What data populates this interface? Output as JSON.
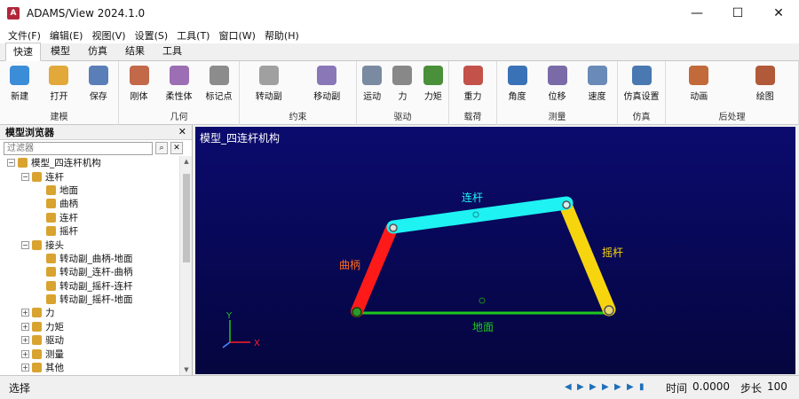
{
  "window": {
    "title": "ADAMS/View 2024.1.0",
    "minimize": "—",
    "maximize": "☐",
    "close": "✕"
  },
  "menu": [
    "文件(F)",
    "编辑(E)",
    "视图(V)",
    "设置(S)",
    "工具(T)",
    "窗口(W)",
    "帮助(H)"
  ],
  "tabs": [
    "快速",
    "模型",
    "仿真",
    "结果",
    "工具"
  ],
  "ribbon": {
    "groups": [
      {
        "label": "建模",
        "tools": [
          {
            "label": "新建",
            "color": "#3c8dd8"
          },
          {
            "label": "打开",
            "color": "#e2a93a"
          },
          {
            "label": "保存",
            "color": "#5a7fb8"
          }
        ]
      },
      {
        "label": "几何",
        "tools": [
          {
            "label": "刚体",
            "color": "#c2694a"
          },
          {
            "label": "柔性体",
            "color": "#9c6fb5"
          },
          {
            "label": "标记点",
            "color": "#8c8c8c"
          }
        ]
      },
      {
        "label": "约束",
        "tools": [
          {
            "label": "转动副",
            "color": "#a0a0a0"
          },
          {
            "label": "移动副",
            "color": "#8a77b8"
          }
        ]
      },
      {
        "label": "驱动",
        "tools": [
          {
            "label": "运动",
            "color": "#7a8aa0"
          },
          {
            "label": "力",
            "color": "#888888"
          },
          {
            "label": "力矩",
            "color": "#4a8f3a"
          }
        ]
      },
      {
        "label": "载荷",
        "tools": [
          {
            "label": "重力",
            "color": "#c2524a"
          }
        ]
      },
      {
        "label": "测量",
        "tools": [
          {
            "label": "角度",
            "color": "#3a72b8"
          },
          {
            "label": "位移",
            "color": "#7a6aa8"
          },
          {
            "label": "速度",
            "color": "#6a8ab8"
          }
        ]
      },
      {
        "label": "仿真",
        "tools": [
          {
            "label": "仿真设置",
            "color": "#4a78b0"
          }
        ]
      },
      {
        "label": "后处理",
        "tools": [
          {
            "label": "动画",
            "color": "#c26a3a"
          },
          {
            "label": "绘图",
            "color": "#b05a3a"
          }
        ]
      }
    ]
  },
  "browser": {
    "title": "模型浏览器",
    "close": "✕",
    "filter_placeholder": "过滤器",
    "tree": [
      {
        "label": "模型_四连杆机构",
        "level": 0,
        "expanded": true
      },
      {
        "label": "连杆",
        "level": 1,
        "expanded": true
      },
      {
        "label": "地面",
        "level": 2
      },
      {
        "label": "曲柄",
        "level": 2
      },
      {
        "label": "连杆",
        "level": 2
      },
      {
        "label": "摇杆",
        "level": 2
      },
      {
        "label": "接头",
        "level": 1,
        "expanded": true
      },
      {
        "label": "转动副_曲柄-地面",
        "level": 2
      },
      {
        "label": "转动副_连杆-曲柄",
        "level": 2
      },
      {
        "label": "转动副_摇杆-连杆",
        "level": 2
      },
      {
        "label": "转动副_摇杆-地面",
        "level": 2
      },
      {
        "label": "力",
        "level": 1,
        "expanded": false
      },
      {
        "label": "力矩",
        "level": 1,
        "expanded": false
      },
      {
        "label": "驱动",
        "level": 1,
        "expanded": false
      },
      {
        "label": "测量",
        "level": 1,
        "expanded": false
      },
      {
        "label": "其他",
        "level": 1,
        "expanded": false
      }
    ]
  },
  "viewport": {
    "title": "模型_四连杆机构",
    "labels": {
      "coupler": "连杆",
      "crank": "曲柄",
      "rocker": "摇杆",
      "ground": "地面"
    },
    "axes": {
      "y": "Y",
      "x": "X"
    },
    "colors": {
      "crank": "#ff1a1a",
      "coupler": "#1ef2f2",
      "rocker": "#f6d50e",
      "ground": "#1ec81e",
      "background": "#0b0b6e"
    }
  },
  "status": {
    "mode": "选择",
    "time_label": "时间",
    "time_value": "0.0000",
    "step_label": "步长",
    "step_value": "100"
  }
}
